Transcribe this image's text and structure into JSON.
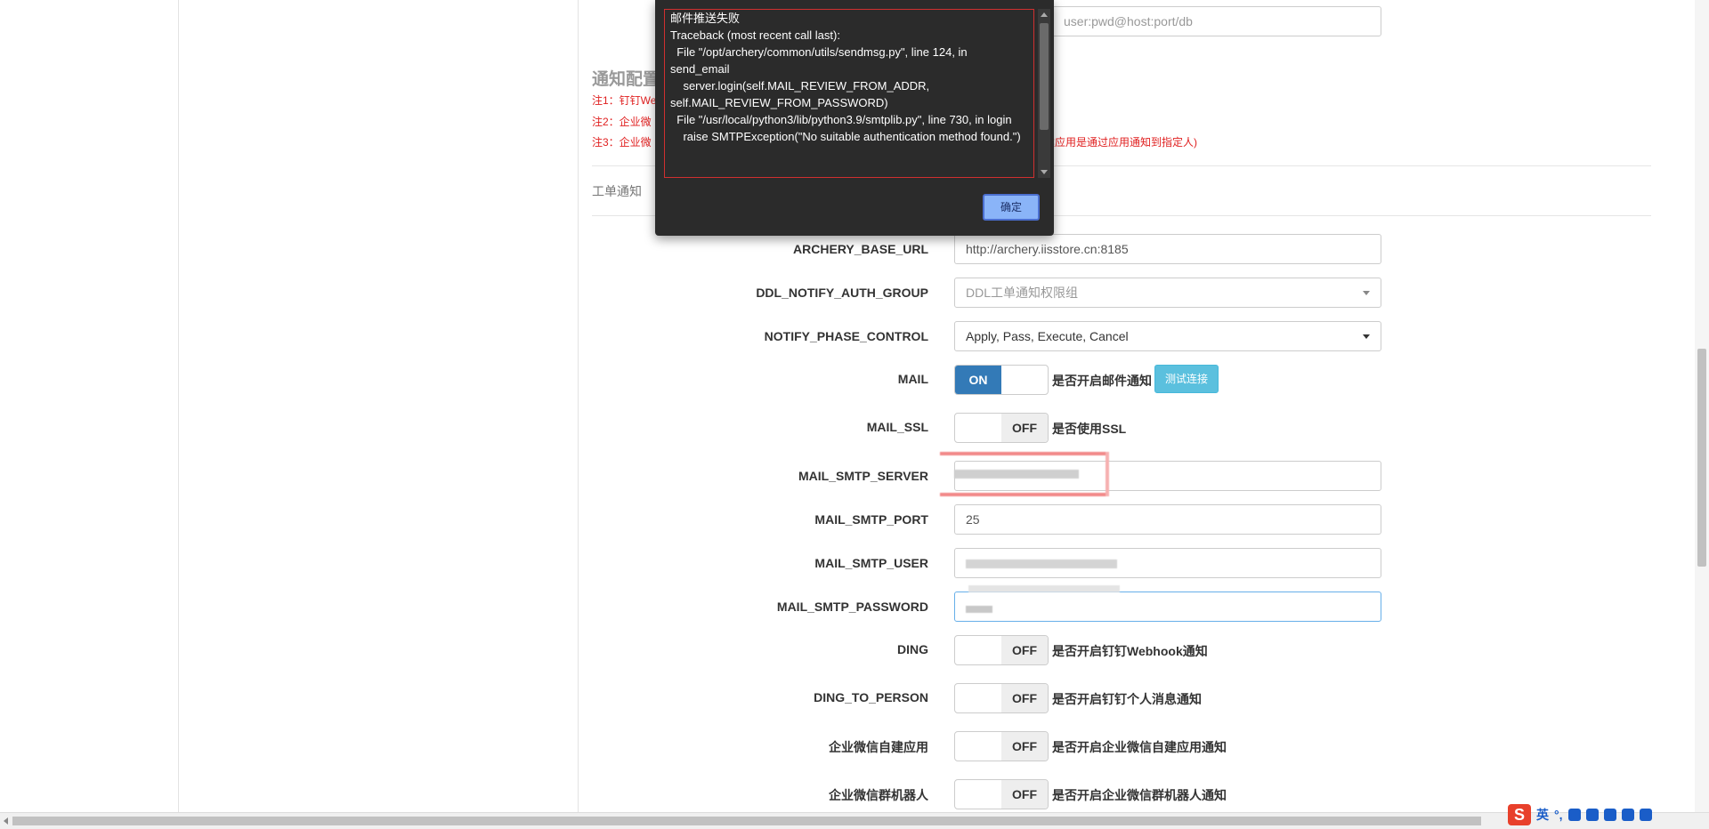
{
  "dialog": {
    "message": "邮件推送失败\nTraceback (most recent call last):\n  File \"/opt/archery/common/utils/sendmsg.py\", line 124, in send_email\n    server.login(self.MAIL_REVIEW_FROM_ADDR, self.MAIL_REVIEW_FROM_PASSWORD)\n  File \"/usr/local/python3/lib/python3.9/smtplib.py\", line 730, in login\n    raise SMTPException(\"No suitable authentication method found.\")",
    "ok_label": "确定"
  },
  "top_input": {
    "placeholder": "user:pwd@host:port/db"
  },
  "notify_section": {
    "title": "通知配置",
    "notes": [
      "注1：钉钉We",
      "注2：企业微",
      "注3：企业微"
    ],
    "note3_tail": "建应用是通过应用通知到指定人)",
    "subsection": "工单通知"
  },
  "fields": [
    {
      "label": "ARCHERY_BASE_URL",
      "value": "http://archery.iisstore.cn:8185"
    },
    {
      "label": "DDL_NOTIFY_AUTH_GROUP",
      "value": "DDL工单通知权限组"
    },
    {
      "label": "NOTIFY_PHASE_CONTROL",
      "value": "Apply, Pass, Execute, Cancel"
    },
    {
      "label": "MAIL_SMTP_SERVER"
    },
    {
      "label": "MAIL_SMTP_PORT",
      "value": "25"
    },
    {
      "label": "MAIL_SMTP_USER"
    },
    {
      "label": "MAIL_SMTP_PASSWORD"
    }
  ],
  "toggles": [
    {
      "label": "MAIL",
      "state": "ON",
      "desc": "是否开启邮件通知"
    },
    {
      "label": "MAIL_SSL",
      "state": "OFF",
      "desc": "是否使用SSL"
    },
    {
      "label": "DING",
      "state": "OFF",
      "desc": "是否开启钉钉Webhook通知"
    },
    {
      "label": "DING_TO_PERSON",
      "state": "OFF",
      "desc": "是否开启钉钉个人消息通知"
    },
    {
      "label": "企业微信自建应用",
      "state": "OFF",
      "desc": "是否开启企业微信自建应用通知"
    },
    {
      "label": "企业微信群机器人",
      "state": "OFF",
      "desc": "是否开启企业微信群机器人通知"
    }
  ],
  "test_button": "测试连接",
  "tray": {
    "ime": "英",
    "punct": "°,"
  },
  "colors": {
    "primary": "#337ab7",
    "info": "#5bc0de",
    "error": "#e02020",
    "dialog_bg": "#2b2b2b"
  }
}
